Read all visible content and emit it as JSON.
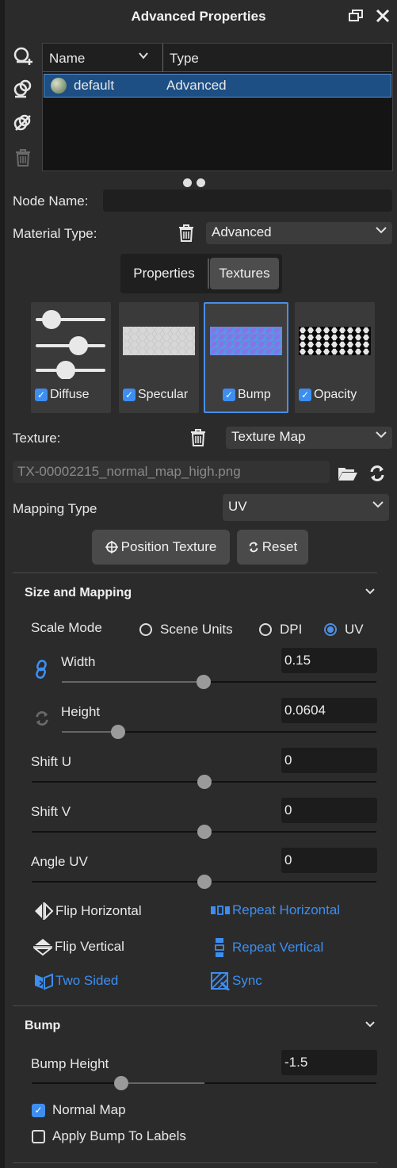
{
  "window": {
    "title": "Advanced Properties"
  },
  "materials_list": {
    "columns": [
      "Name",
      "Type"
    ],
    "rows": [
      {
        "name": "default",
        "type": "Advanced"
      }
    ]
  },
  "node_name": {
    "label": "Node Name:",
    "value": ""
  },
  "material_type": {
    "label": "Material Type:",
    "value": "Advanced"
  },
  "tabs": {
    "properties": "Properties",
    "textures": "Textures",
    "active": "Textures"
  },
  "texture_tiles": [
    {
      "label": "Diffuse",
      "checked": true,
      "selected": false
    },
    {
      "label": "Specular",
      "checked": true,
      "selected": false
    },
    {
      "label": "Bump",
      "checked": true,
      "selected": true
    },
    {
      "label": "Opacity",
      "checked": true,
      "selected": false
    }
  ],
  "texture": {
    "label": "Texture:",
    "value": "Texture Map",
    "file": "TX-00002215_normal_map_high.png"
  },
  "mapping_type": {
    "label": "Mapping Type",
    "value": "UV"
  },
  "buttons": {
    "position_texture": "Position Texture",
    "reset": "Reset"
  },
  "size_mapping": {
    "title": "Size and Mapping",
    "scale_mode_label": "Scale Mode",
    "scale_modes": [
      "Scene Units",
      "DPI",
      "UV"
    ],
    "scale_mode_selected": "UV",
    "width": {
      "label": "Width",
      "value": "0.15",
      "slider": 0.45
    },
    "height": {
      "label": "Height",
      "value": "0.0604",
      "slider": 0.18
    },
    "shift_u": {
      "label": "Shift U",
      "value": "0",
      "slider": 0.5
    },
    "shift_v": {
      "label": "Shift V",
      "value": "0",
      "slider": 0.5
    },
    "angle_uv": {
      "label": "Angle UV",
      "value": "0",
      "slider": 0.5
    },
    "flip_horizontal": "Flip Horizontal",
    "repeat_horizontal": "Repeat Horizontal",
    "flip_vertical": "Flip Vertical",
    "repeat_vertical": "Repeat Vertical",
    "two_sided": "Two Sided",
    "sync": "Sync"
  },
  "bump": {
    "title": "Bump",
    "bump_height": {
      "label": "Bump Height",
      "value": "-1.5",
      "slider": 0.26
    },
    "normal_map": {
      "label": "Normal Map",
      "checked": true
    },
    "apply_to_labels": {
      "label": "Apply Bump To Labels",
      "checked": false
    }
  },
  "colors": {
    "accent": "#3d8ef0",
    "background": "#2b2b2b",
    "selection": "#1d4f85"
  }
}
